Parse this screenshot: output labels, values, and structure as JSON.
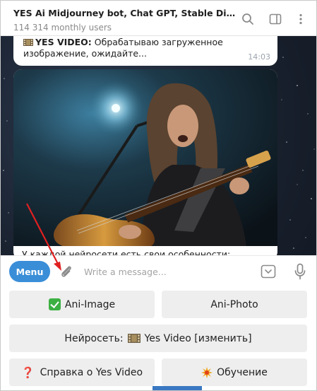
{
  "header": {
    "title": "YES Ai Midjourney bot, Chat GPT, Stable Diffusion",
    "subtitle": "114 314 monthly users",
    "icons": [
      "search-icon",
      "sidebar-toggle-icon",
      "more-vertical-icon"
    ]
  },
  "messages": {
    "bubble1": {
      "sender": "YES VIDEO:",
      "text_line1": "Обрабатываю загруженное",
      "text_line2": "изображение, ожидайте...",
      "time": "14:03"
    },
    "photo_caption": "У каждой нейросети есть свои особенности:"
  },
  "input": {
    "menu_label": "Menu",
    "placeholder": "Write a message..."
  },
  "keyboard": {
    "row1": [
      "Ani-Image",
      "Ani-Photo"
    ],
    "row2": "Нейросеть:  Yes Video [изменить]",
    "row2_prefix": "Нейросеть:",
    "row2_suffix": "Yes Video [изменить]",
    "row3": [
      "Справка о Yes Video",
      "Обучение"
    ]
  },
  "colors": {
    "menu_button": "#3a8ed8",
    "annotation_arrow": "#e02020",
    "key_background": "#eeeeee"
  }
}
